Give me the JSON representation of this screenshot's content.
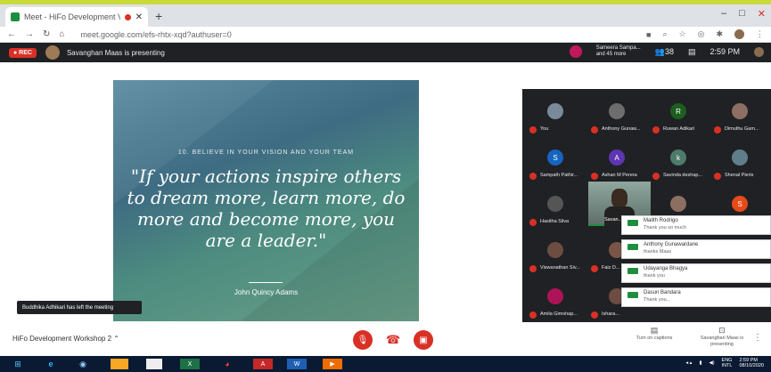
{
  "browser": {
    "tab_title": "Meet - HiFo Development V",
    "new_tab": "+",
    "url": "meet.google.com/efs-rhtx-xqd?authuser=0",
    "window_controls": [
      "–",
      "□",
      "✕"
    ]
  },
  "meet_header": {
    "rec_label": "● REC",
    "presenting_text": "Savanghan Maas is presenting",
    "participants_line1": "Sameera Sampa...",
    "participants_line2": "and 45 more",
    "participant_count": "38",
    "time": "2:59 PM"
  },
  "slide": {
    "heading": "10. BELIEVE IN YOUR VISION AND YOUR TEAM",
    "quote": "\"If your actions inspire others to dream more, learn more, do more and become more, you are a leader.\"",
    "author": "John Quincy Adams"
  },
  "toast": "Buddhika Adhikari has left the meeting",
  "participants": [
    {
      "name": "You",
      "initial": "",
      "color": "#7a8a9a"
    },
    {
      "name": "Anthony Gunaw...",
      "initial": "",
      "color": "#6d6d6d"
    },
    {
      "name": "Ruwan Adikari",
      "initial": "R",
      "color": "#1b5e20"
    },
    {
      "name": "Dimuthu Gam...",
      "initial": "",
      "color": "#8d6e63"
    },
    {
      "name": "Sampath Pathir...",
      "initial": "S",
      "color": "#1565c0"
    },
    {
      "name": "Ashan M Perera",
      "initial": "A",
      "color": "#5e35b1"
    },
    {
      "name": "Savinda deshap...",
      "initial": "k",
      "color": "#4e7a6a"
    },
    {
      "name": "Shenal Pieris",
      "initial": "",
      "color": "#607d8b"
    },
    {
      "name": "Hasitha Silva",
      "initial": "",
      "color": "#555"
    },
    {
      "name": "",
      "initial": "",
      "color": "#8d6e63"
    },
    {
      "name": "",
      "initial": "S",
      "color": "#e64a19"
    },
    {
      "name": "Viswanathan Siv...",
      "initial": "",
      "color": "#6d4c41"
    },
    {
      "name": "Faiz D...",
      "initial": "",
      "color": "#795548"
    },
    {
      "name": "Amila Gimshap...",
      "initial": "",
      "color": "#ad1457"
    },
    {
      "name": "Ishara...",
      "initial": "",
      "color": "#6d4c41"
    }
  ],
  "self_view_name": "Savan...",
  "chat": [
    {
      "sender": "Malith Rodrigo",
      "text": "Thank you so much"
    },
    {
      "sender": "Anthony Gunawardane",
      "text": "thanks Maas"
    },
    {
      "sender": "Udayanga Bhagya",
      "text": "thank you"
    },
    {
      "sender": "Dasun Bandara",
      "text": "Thank you..."
    }
  ],
  "bottom": {
    "meeting_name": "HiFo Development Workshop 2",
    "captions_label": "Turn on captions",
    "presenting_label": "Savanghan Maas is presenting",
    "more": "⋮"
  },
  "taskbar": {
    "lang": "ENG",
    "region": "INTL",
    "time": "2:59 PM",
    "date": "08/10/2020"
  }
}
